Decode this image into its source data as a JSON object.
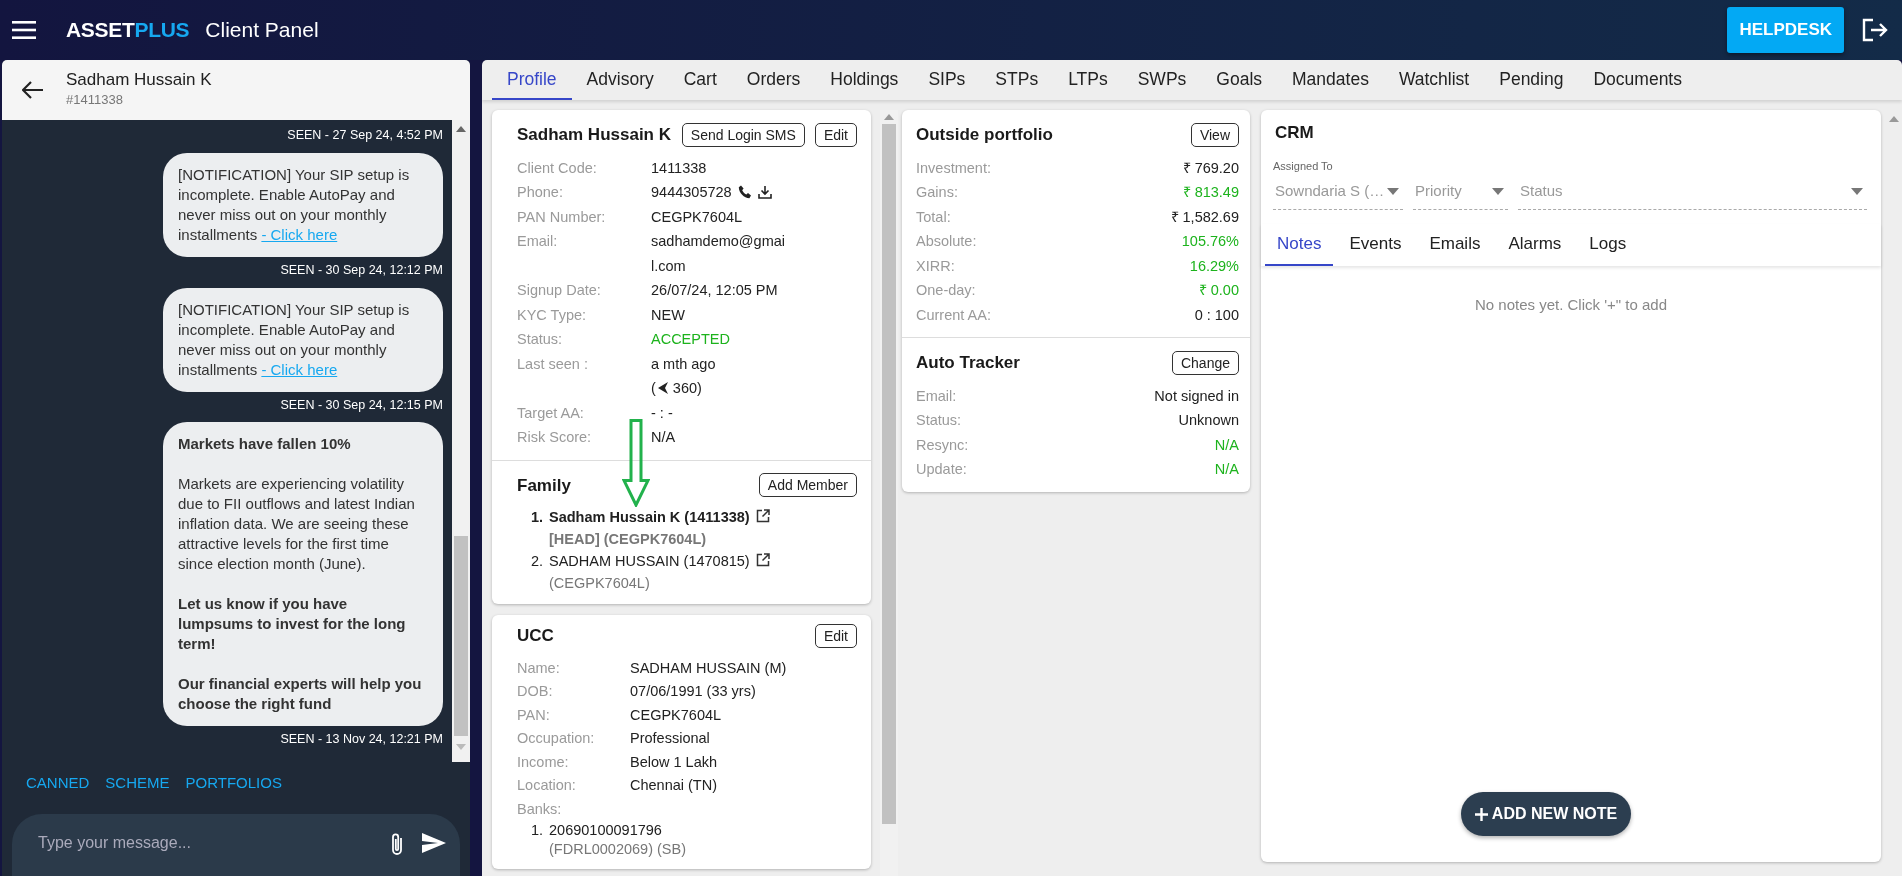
{
  "app": {
    "logo_primary": "ASSET",
    "logo_accent": "PLUS",
    "panel_title": "Client Panel",
    "helpdesk": "HELPDESK"
  },
  "chat": {
    "name": "Sadham Hussain K",
    "client_id": "#1411338",
    "messages": [
      {
        "kind": "seen",
        "text": "SEEN - 27 Sep 24, 4:52 PM"
      },
      {
        "kind": "notification",
        "text": "[NOTIFICATION] Your SIP setup is incomplete. Enable AutoPay and never miss out on your monthly installments ",
        "link": "- Click here"
      },
      {
        "kind": "seen",
        "text": "SEEN - 30 Sep 24, 12:12 PM"
      },
      {
        "kind": "notification",
        "text": "[NOTIFICATION] Your SIP setup is incomplete. Enable AutoPay and never miss out on your monthly installments ",
        "link": "- Click here"
      },
      {
        "kind": "seen",
        "text": "SEEN - 30 Sep 24, 12:15 PM"
      },
      {
        "kind": "rich",
        "paragraphs": [
          {
            "text": "Markets have fallen 10%",
            "bold": true
          },
          {
            "text": "Markets are experiencing volatility due to FII outflows and latest Indian inflation data. We are seeing these attractive levels for the first time since election month (June).",
            "bold": false
          },
          {
            "text": "Let us know if you have lumpsums to invest for the long term!",
            "bold": true
          },
          {
            "text": "Our financial experts will help you choose the right fund",
            "bold": true
          }
        ]
      },
      {
        "kind": "seen",
        "text": "SEEN - 13 Nov 24, 12:21 PM"
      }
    ],
    "quick_tabs": [
      "CANNED",
      "SCHEME",
      "PORTFOLIOS"
    ],
    "input": {
      "placeholder": "Type your message..."
    }
  },
  "tabs": [
    {
      "label": "Profile",
      "selected": true
    },
    {
      "label": "Advisory",
      "selected": false
    },
    {
      "label": "Cart",
      "selected": false
    },
    {
      "label": "Orders",
      "selected": false
    },
    {
      "label": "Holdings",
      "selected": false
    },
    {
      "label": "SIPs",
      "selected": false
    },
    {
      "label": "STPs",
      "selected": false
    },
    {
      "label": "LTPs",
      "selected": false
    },
    {
      "label": "SWPs",
      "selected": false
    },
    {
      "label": "Goals",
      "selected": false
    },
    {
      "label": "Mandates",
      "selected": false
    },
    {
      "label": "Watchlist",
      "selected": false
    },
    {
      "label": "Pending",
      "selected": false
    },
    {
      "label": "Documents",
      "selected": false
    }
  ],
  "profile": {
    "name": "Sadham Hussain K",
    "buttons": [
      "Send Login SMS",
      "Edit"
    ],
    "fields": [
      {
        "label": "Client Code:",
        "value": "1411338",
        "kind": "text",
        "positive": false
      },
      {
        "label": "Phone:",
        "value": "9444305728",
        "kind": "phone",
        "positive": false
      },
      {
        "label": "PAN Number:",
        "value": "CEGPK7604L",
        "kind": "text",
        "positive": false
      },
      {
        "label": "Email:",
        "value": "sadhamdemo@gmail.com",
        "kind": "text",
        "positive": false
      },
      {
        "label": "Signup Date:",
        "value": "26/07/24, 12:05 PM",
        "kind": "text",
        "positive": false
      },
      {
        "label": "KYC Type:",
        "value": "NEW",
        "kind": "text",
        "positive": false
      },
      {
        "label": "Status:",
        "value": "ACCEPTED",
        "kind": "text",
        "positive": true
      },
      {
        "label": "Last seen :",
        "value": "a mth ago",
        "kind": "last_seen",
        "positive": false,
        "extra_open": "(",
        "extra": "360)"
      },
      {
        "label": "Target AA:",
        "value": "- : -",
        "kind": "text",
        "positive": false
      },
      {
        "label": "Risk Score:",
        "value": "N/A",
        "kind": "text",
        "positive": false
      }
    ]
  },
  "family": {
    "title": "Family",
    "button": "Add Member",
    "members": [
      {
        "marker": "1.",
        "name": "Sadham Hussain K (1411338)",
        "detail": "[HEAD]  (CEGPK7604L)",
        "head": true
      },
      {
        "marker": "2.",
        "name": "SADHAM HUSSAIN (1470815)",
        "detail": "(CEGPK7604L)",
        "head": false
      }
    ]
  },
  "ucc": {
    "title": "UCC",
    "button": "Edit",
    "fields": [
      {
        "label": "Name:",
        "value": "SADHAM HUSSAIN (M)"
      },
      {
        "label": "DOB:",
        "value": "07/06/1991 (33 yrs)"
      },
      {
        "label": "PAN:",
        "value": "CEGPK7604L"
      },
      {
        "label": "Occupation:",
        "value": "Professional"
      },
      {
        "label": "Income:",
        "value": "Below 1 Lakh"
      },
      {
        "label": "Location:",
        "value": "Chennai (TN)"
      }
    ],
    "banks_label": "Banks:",
    "banks": [
      {
        "marker": "1.",
        "number": "20690100091796",
        "detail": "(FDRL0002069) (SB)"
      }
    ]
  },
  "outside_portfolio": {
    "title": "Outside portfolio",
    "button": "View",
    "rows": [
      {
        "label": "Investment:",
        "value": "₹ 769.20",
        "positive": false
      },
      {
        "label": "Gains:",
        "value": "₹ 813.49",
        "positive": true
      },
      {
        "label": "Total:",
        "value": "₹ 1,582.69",
        "positive": false
      },
      {
        "label": "Absolute:",
        "value": "105.76%",
        "positive": true
      },
      {
        "label": "XIRR:",
        "value": "16.29%",
        "positive": true
      },
      {
        "label": "One-day:",
        "value": "₹ 0.00",
        "positive": true
      },
      {
        "label": "Current AA:",
        "value": "0 : 100",
        "positive": false
      }
    ]
  },
  "auto_tracker": {
    "title": "Auto Tracker",
    "button": "Change",
    "rows": [
      {
        "label": "Email:",
        "value": "Not signed in",
        "positive": false
      },
      {
        "label": "Status:",
        "value": "Unknown",
        "positive": false
      },
      {
        "label": "Resync:",
        "value": "N/A",
        "positive": true
      },
      {
        "label": "Update:",
        "value": "N/A",
        "positive": true
      }
    ]
  },
  "crm": {
    "title": "CRM",
    "assigned_label": "Assigned To",
    "selects": [
      {
        "value": "Sowndaria S (…"
      },
      {
        "placeholder": "Priority"
      },
      {
        "placeholder": "Status"
      }
    ],
    "tabs": [
      {
        "label": "Notes",
        "selected": true
      },
      {
        "label": "Events",
        "selected": false
      },
      {
        "label": "Emails",
        "selected": false
      },
      {
        "label": "Alarms",
        "selected": false
      },
      {
        "label": "Logs",
        "selected": false
      }
    ],
    "empty_text": "No notes yet. Click '+\" to add",
    "add_button": "ADD NEW NOTE"
  }
}
